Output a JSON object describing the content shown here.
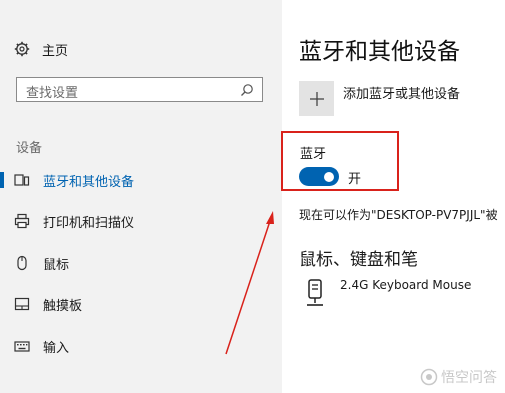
{
  "sidebar": {
    "home_label": "主页",
    "search_placeholder": "查找设置",
    "section_title": "设备",
    "items": [
      {
        "label": "蓝牙和其他设备",
        "icon": "bluetooth-devices-icon",
        "active": true
      },
      {
        "label": "打印机和扫描仪",
        "icon": "printer-icon",
        "active": false
      },
      {
        "label": "鼠标",
        "icon": "mouse-icon",
        "active": false
      },
      {
        "label": "触摸板",
        "icon": "touchpad-icon",
        "active": false
      },
      {
        "label": "输入",
        "icon": "keyboard-icon",
        "active": false
      }
    ]
  },
  "main": {
    "title": "蓝牙和其他设备",
    "add_device_label": "添加蓝牙或其他设备",
    "bluetooth_label": "蓝牙",
    "bluetooth_state": "开",
    "bluetooth_on": true,
    "discoverable_text": "现在可以作为\"DESKTOP-PV7PJJL\"被",
    "section_title": "鼠标、键盘和笔",
    "devices": [
      {
        "name": "2.4G Keyboard Mouse",
        "icon": "keyboard-mouse-device-icon"
      }
    ]
  },
  "watermark": {
    "text": "悟空问答"
  },
  "colors": {
    "accent": "#0063b1",
    "sidebar_bg": "#f2f2f2",
    "highlight": "#d9221b"
  }
}
